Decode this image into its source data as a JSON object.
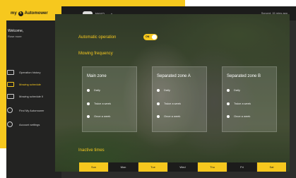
{
  "colors": {
    "accent": "#f6c81e",
    "sidebar": "#232322",
    "topbar": "#1c1c1b"
  },
  "topbar": {
    "logo_my": "my",
    "logo_badge": "h",
    "logo_brand": "Automower",
    "mower_name": "MAYO",
    "synced_text": "Synced: 15 mins ago"
  },
  "sidebar": {
    "welcome": "Welcome,",
    "user_name": "Rose more",
    "items": [
      {
        "label": "Operation history",
        "icon": "monitor-icon",
        "active": false
      },
      {
        "label": "Mowing schedule",
        "icon": "schedule-icon",
        "active": true
      },
      {
        "label": "Mowing schedule II",
        "icon": "schedule-icon",
        "active": false
      },
      {
        "label": "Find My Automower",
        "icon": "location-icon",
        "active": false
      },
      {
        "label": "Account settings",
        "icon": "settings-icon",
        "active": false
      }
    ]
  },
  "main": {
    "automatic_operation_label": "Automatic operation",
    "toggle_text": "ON",
    "toggle_on": true,
    "mowing_frequency_label": "Mowing frequency",
    "zones": [
      {
        "title": "Main zone",
        "options": [
          "Daily",
          "Twice a week",
          "Once a week"
        ]
      },
      {
        "title": "Separated zone A",
        "options": [
          "Daily",
          "Twice a week",
          "Once a week"
        ]
      },
      {
        "title": "Separated zone B",
        "options": [
          "Daily",
          "Twice a week",
          "Once a week"
        ]
      }
    ],
    "inactive_times_label": "Inactive times",
    "days": [
      {
        "label": "Sun",
        "highlight": true
      },
      {
        "label": "Mon",
        "highlight": false
      },
      {
        "label": "Tue",
        "highlight": true
      },
      {
        "label": "Wed",
        "highlight": false
      },
      {
        "label": "Thu",
        "highlight": true
      },
      {
        "label": "Fri",
        "highlight": false
      },
      {
        "label": "Sat",
        "highlight": true
      }
    ]
  }
}
